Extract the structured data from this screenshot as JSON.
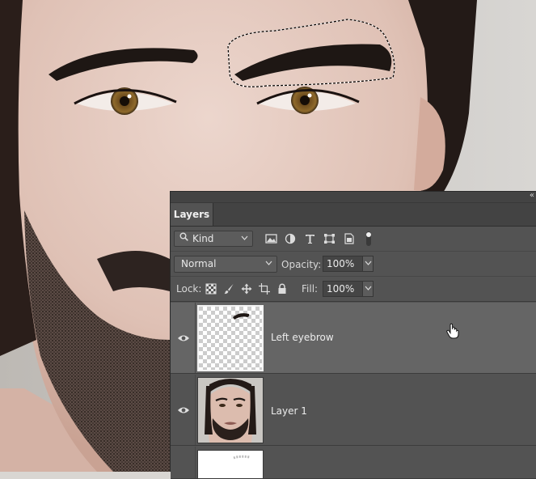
{
  "panel": {
    "tab_label": "Layers",
    "collapse_glyph": "«",
    "filter": {
      "kind_label": "Kind",
      "search_glyph": "🔍",
      "chevron_glyph": "⌄"
    },
    "blend": {
      "mode": "Normal",
      "opacity_label": "Opacity:",
      "opacity_value": "100%"
    },
    "lock": {
      "label": "Lock:",
      "fill_label": "Fill:",
      "fill_value": "100%"
    },
    "layers": [
      {
        "name": "Left eyebrow",
        "visible": true,
        "selected": true
      },
      {
        "name": "Layer 1",
        "visible": true,
        "selected": false
      },
      {
        "name": "",
        "visible": false,
        "selected": false
      }
    ]
  },
  "icons": {
    "filter_icons": [
      "image-filter-icon",
      "adjustment-filter-icon",
      "type-filter-icon",
      "shape-filter-icon",
      "smart-object-filter-icon",
      "filter-toggle-icon"
    ],
    "lock_icons": [
      "lock-transparent-icon",
      "lock-paint-icon",
      "lock-move-icon",
      "lock-artboard-icon",
      "lock-all-icon"
    ]
  },
  "colors": {
    "panel_bg": "#535353",
    "selected_row": "#656565",
    "tab_bar": "#434343"
  }
}
